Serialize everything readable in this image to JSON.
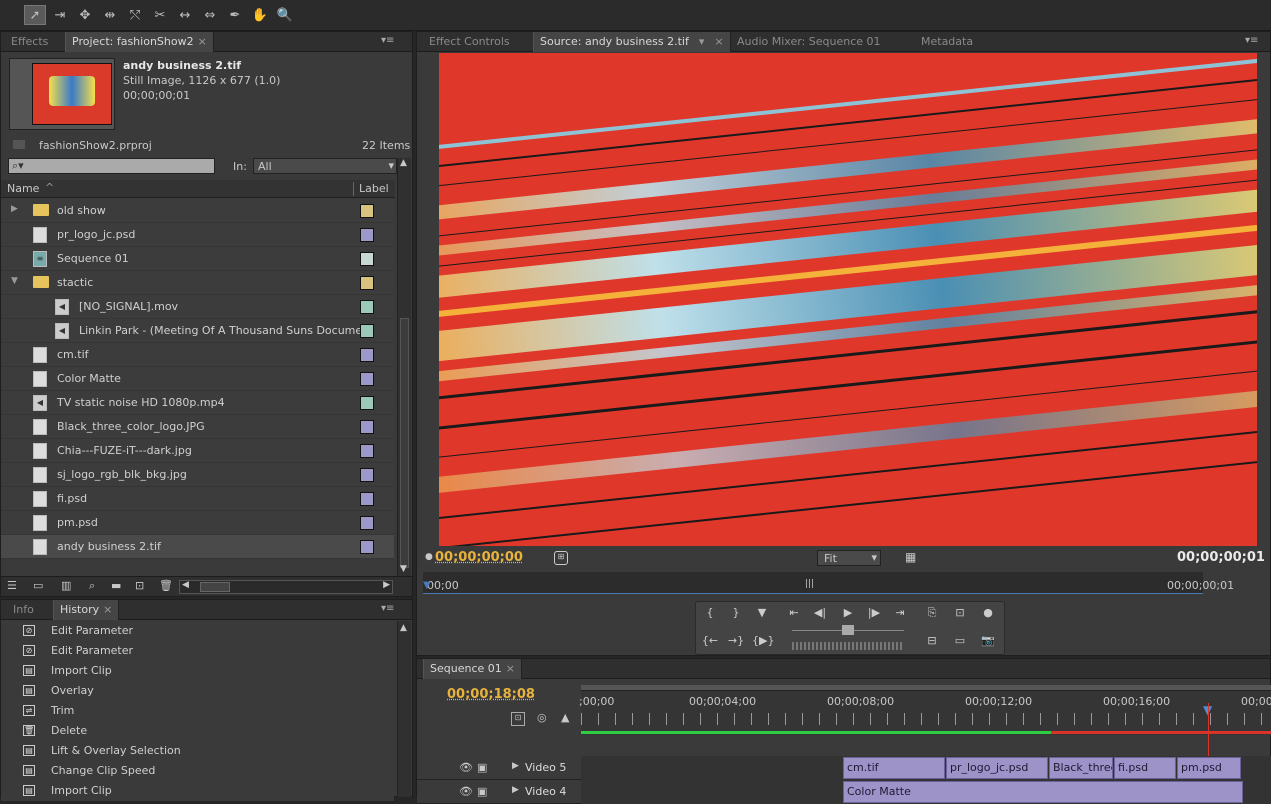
{
  "toolbar": {
    "tools": [
      "selection-tool",
      "track-select-tool",
      "ripple-edit-tool",
      "rolling-edit-tool",
      "rate-stretch-tool",
      "razor-tool",
      "slip-tool",
      "slide-tool",
      "pen-tool",
      "hand-tool",
      "zoom-tool"
    ],
    "glyphs": [
      "➚",
      "⇥",
      "✥",
      "⇹",
      "⤲",
      "✂",
      "↔",
      "⇔",
      "✒",
      "✋",
      "🔍"
    ]
  },
  "project_panel": {
    "tabs": {
      "effects": "Effects",
      "project": "Project: fashionShow2"
    },
    "preview": {
      "name": "andy business 2.tif",
      "type": "Still Image, 1126 x 677 (1.0)",
      "duration": "00;00;00;01"
    },
    "project_file": "fashionShow2.prproj",
    "item_count": "22 Items",
    "search_placeholder": "",
    "in_label": "In:",
    "in_value": "All",
    "columns": {
      "name": "Name",
      "label": "Label"
    },
    "items": [
      {
        "name": "old show",
        "kind": "folder",
        "expand": "▶",
        "color": "#d9c17f",
        "indent": 0
      },
      {
        "name": "pr_logo_jc.psd",
        "kind": "file",
        "expand": "",
        "color": "#9c98c7",
        "indent": 0
      },
      {
        "name": "Sequence 01",
        "kind": "sequence",
        "expand": "",
        "color": "#c8d8d0",
        "indent": 0
      },
      {
        "name": "stactic",
        "kind": "folder",
        "expand": "▼",
        "color": "#d9c17f",
        "indent": 0
      },
      {
        "name": "[NO_SIGNAL].mov",
        "kind": "audio",
        "expand": "",
        "color": "#9cc8b8",
        "indent": 1
      },
      {
        "name": "Linkin Park - (Meeting Of A Thousand Suns Docume",
        "kind": "audio",
        "expand": "",
        "color": "#9cc8b8",
        "indent": 1
      },
      {
        "name": "cm.tif",
        "kind": "file",
        "expand": "",
        "color": "#9c98c7",
        "indent": 0
      },
      {
        "name": "Color Matte",
        "kind": "file",
        "expand": "",
        "color": "#9c98c7",
        "indent": 0
      },
      {
        "name": "TV static noise HD 1080p.mp4",
        "kind": "audio",
        "expand": "",
        "color": "#9cc8b8",
        "indent": 0
      },
      {
        "name": "Black_three_color_logo.JPG",
        "kind": "file",
        "expand": "",
        "color": "#9c98c7",
        "indent": 0
      },
      {
        "name": "Chia---FUZE-iT---dark.jpg",
        "kind": "file",
        "expand": "",
        "color": "#9c98c7",
        "indent": 0
      },
      {
        "name": "sj_logo_rgb_blk_bkg.jpg",
        "kind": "file",
        "expand": "",
        "color": "#9c98c7",
        "indent": 0
      },
      {
        "name": "fi.psd",
        "kind": "file",
        "expand": "",
        "color": "#9c98c7",
        "indent": 0
      },
      {
        "name": "pm.psd",
        "kind": "file",
        "expand": "",
        "color": "#9c98c7",
        "indent": 0
      },
      {
        "name": "andy business 2.tif",
        "kind": "file",
        "expand": "",
        "color": "#9c98c7",
        "indent": 0,
        "selected": true
      }
    ]
  },
  "history_panel": {
    "tabs": {
      "info": "Info",
      "history": "History"
    },
    "items": [
      {
        "label": "Edit Parameter",
        "icon": "⊘"
      },
      {
        "label": "Edit Parameter",
        "icon": "⊘"
      },
      {
        "label": "Import Clip",
        "icon": "▤"
      },
      {
        "label": "Overlay",
        "icon": "▤"
      },
      {
        "label": "Trim",
        "icon": "⇌"
      },
      {
        "label": "Delete",
        "icon": "🗑"
      },
      {
        "label": "Lift & Overlay Selection",
        "icon": "▤"
      },
      {
        "label": "Change Clip Speed",
        "icon": "▤"
      },
      {
        "label": "Import Clip",
        "icon": "▤"
      }
    ]
  },
  "source_monitor": {
    "tabs": {
      "effect_controls": "Effect Controls",
      "source": "Source: andy business 2.tif",
      "audio_mixer": "Audio Mixer: Sequence 01",
      "metadata": "Metadata"
    },
    "timecode_in": "00;00;00;00",
    "timecode_duration": "00;00;00;01",
    "fit": "Fit",
    "ruler_start": "00;00",
    "ruler_end": "00;00;00;01",
    "ruler_mid": "|||"
  },
  "timeline": {
    "tab": "Sequence 01",
    "timecode": "00;00;18;08",
    "ruler_labels": [
      ";00;00",
      "00;00;04;00",
      "00;00;08;00",
      "00;00;12;00",
      "00;00;16;00",
      "00;00"
    ],
    "tracks": [
      {
        "name": "Video 5",
        "clips": [
          "cm.tif",
          "pr_logo_jc.psd",
          "Black_three",
          "fi.psd",
          "pm.psd"
        ]
      },
      {
        "name": "Video 4",
        "clips": [
          "Color Matte"
        ]
      }
    ]
  },
  "colors": {
    "accent": "#e8b33c",
    "clip": "#9d93c9",
    "playhead": "#d9332a",
    "folder": "#e6c35c"
  }
}
